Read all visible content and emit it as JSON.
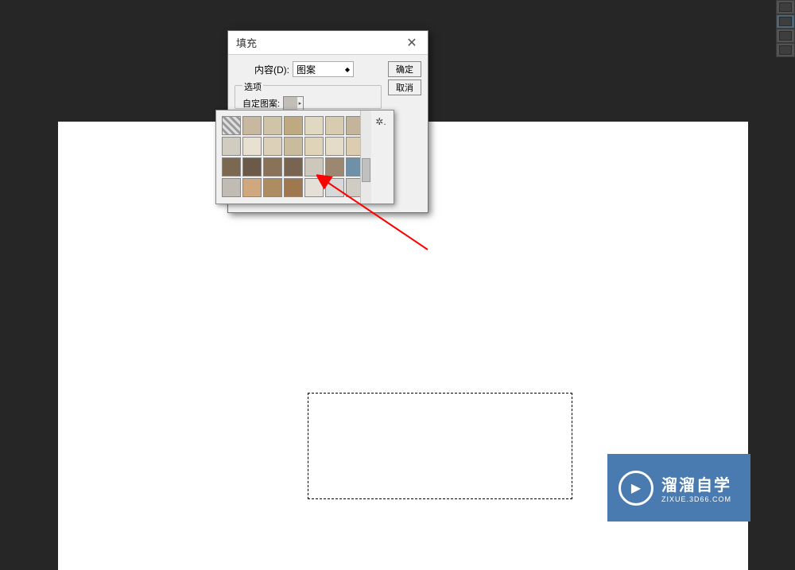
{
  "dialog": {
    "title": "填充",
    "content_label": "内容(D):",
    "content_value": "图案",
    "options_label": "选项",
    "custom_label": "自定图案:",
    "ok_label": "确定",
    "cancel_label": "取消"
  },
  "patterns": {
    "colors": [
      "#e8e4d8",
      "#c8b8a0",
      "#d0c4a8",
      "#bfa980",
      "#e0d8c0",
      "#d8ccb0",
      "#c4b49c",
      "#d0ccc0",
      "#e8e0d0",
      "#dcd0b8",
      "#c8bc9c",
      "#e0d4b8",
      "#e4dcc8",
      "#dcccb0",
      "#7a6850",
      "#6c5a48",
      "#8a7258",
      "#786450",
      "#cec8bc",
      "#9c8870",
      "#7090a8",
      "#c0bcb4",
      "#d0a880",
      "#ac8c60",
      "#a07850",
      "#e4e0d8",
      "#d8d8d8",
      "#d0ccc4"
    ]
  },
  "watermark": {
    "title": "溜溜自学",
    "subtitle": "ZIXUE.3D66.COM",
    "play_icon": "▶"
  }
}
